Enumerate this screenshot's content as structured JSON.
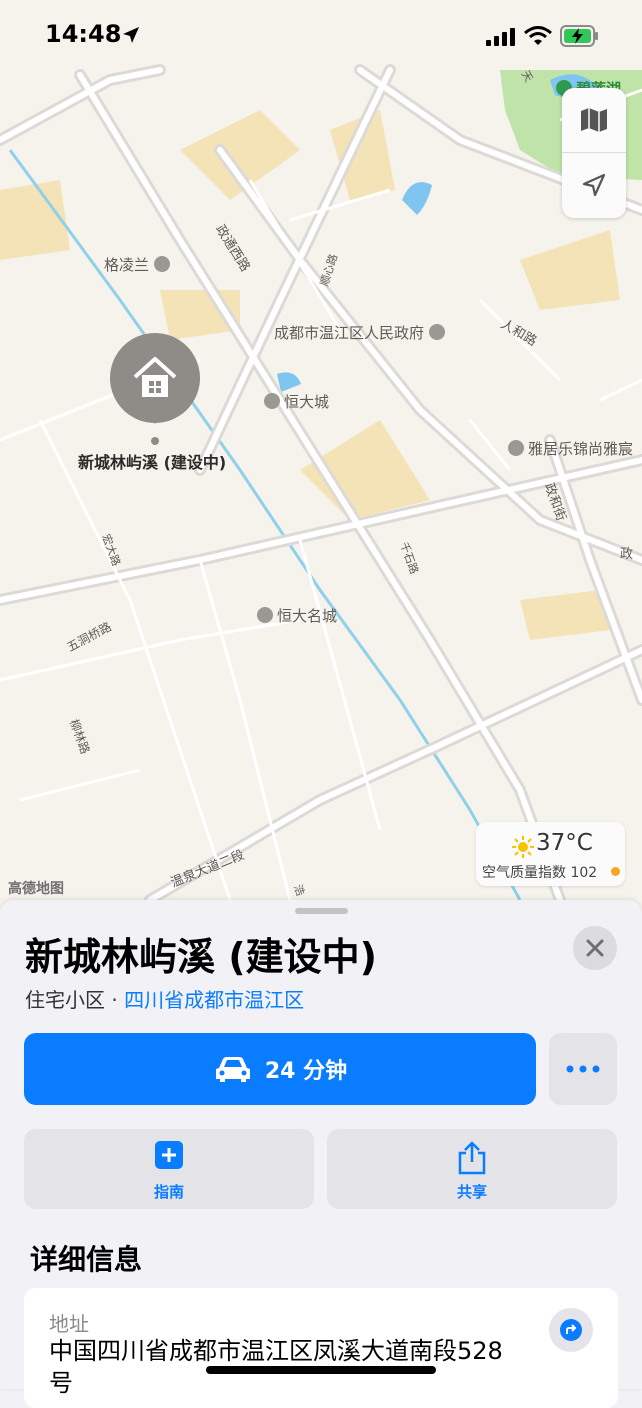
{
  "status_bar": {
    "time": "14:48"
  },
  "map": {
    "roads": [
      "政通西路",
      "顺心路",
      "人和路",
      "政和街",
      "千石路",
      "宏大路",
      "五洞桥路",
      "柳林路",
      "温泉大道二段",
      "政",
      "浩",
      "天"
    ],
    "pois": [
      "格凌兰",
      "成都市温江区人民政府",
      "恒大城",
      "雅居乐锦尚雅宸",
      "恒大名城",
      "碧莲湖"
    ],
    "pin_label": "新城林屿溪 (建设中)",
    "brand": "高德地图",
    "weather": {
      "temp": "37°C",
      "aqi": "空气质量指数 102"
    },
    "controls": [
      "map-mode-icon",
      "location-arrow-icon"
    ]
  },
  "place": {
    "title": "新城林屿溪 (建设中)",
    "category": "住宅小区 · ",
    "region": "四川省成都市温江区",
    "drive_time": "24 分钟",
    "actions": [
      {
        "label": "指南",
        "icon": "plus-icon"
      },
      {
        "label": "共享",
        "icon": "share-icon"
      }
    ],
    "section_title": "详细信息",
    "address_label": "地址",
    "address_value": "中国四川省成都市温江区凤溪大道南段528号"
  },
  "colors": {
    "accent": "#0a7cff",
    "map_bg": "#f6f3ec",
    "pin": "#8f8c88"
  }
}
